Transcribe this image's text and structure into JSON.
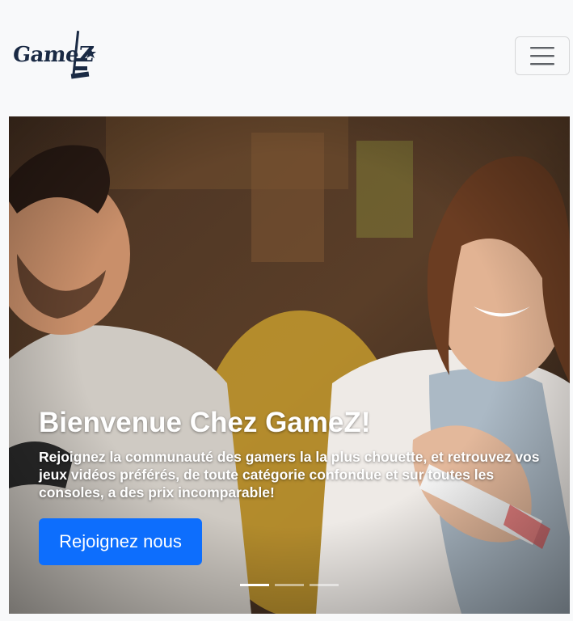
{
  "navbar": {
    "brand_name": "GameZ",
    "toggle_icon": "hamburger-menu-icon"
  },
  "hero": {
    "title": "Bienvenue Chez GameZ!",
    "description": "Rejoignez la communauté des gamers la la plus chouette, et retrouvez vos jeux vidéos préférés, de toute catégorie confondue et sur toutes les consoles, a des prix incomparable!",
    "cta_label": "Rejoignez nous",
    "slides_count": 3,
    "active_slide": 1
  },
  "colors": {
    "primary": "#0d6efd",
    "navbar_bg": "#f8f9fa",
    "brand_text": "#1a2a44"
  }
}
